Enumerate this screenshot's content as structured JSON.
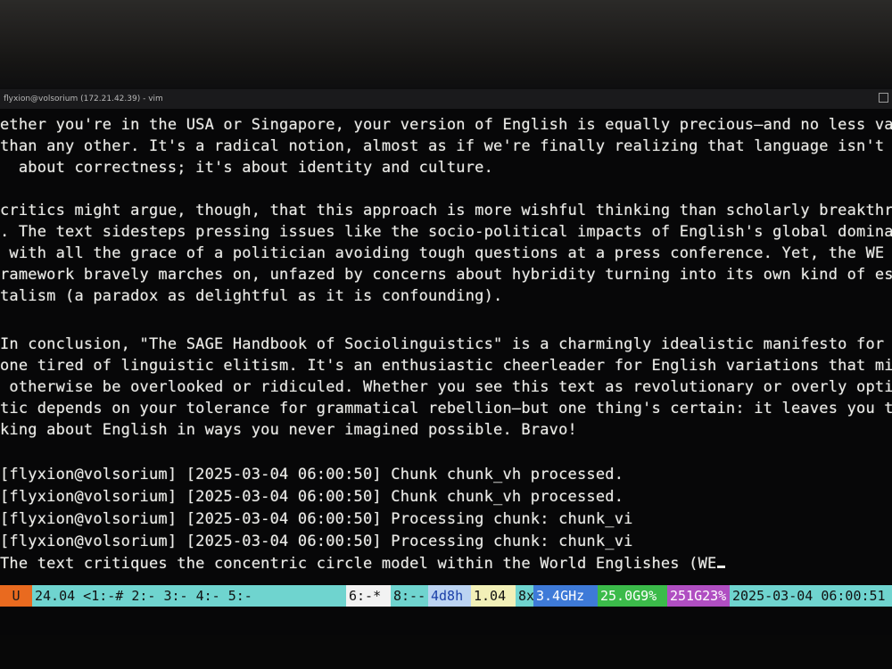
{
  "window": {
    "title": "flyxion@volsorium (172.21.42.39) - vim"
  },
  "terminal": {
    "lines": [
      "ether you're in the USA or Singapore, your version of English is equally precious—and no less vali",
      "than any other. It's a radical notion, almost as if we're finally realizing that language isn't j",
      "  about correctness; it's about identity and culture.",
      "",
      "critics might argue, though, that this approach is more wishful thinking than scholarly breakthro",
      ". The text sidesteps pressing issues like the socio-political impacts of English's global dominan",
      " with all the grace of a politician avoiding tough questions at a press conference. Yet, the WE f",
      "ramework bravely marches on, unfazed by concerns about hybridity turning into its own kind of essen",
      "talism (a paradox as delightful as it is confounding).",
      "",
      "In conclusion, \"The SAGE Handbook of Sociolinguistics\" is a charmingly idealistic manifesto for an",
      "one tired of linguistic elitism. It's an enthusiastic cheerleader for English variations that migh",
      " otherwise be overlooked or ridiculed. Whether you see this text as revolutionary or overly optimi",
      "tic depends on your tolerance for grammatical rebellion—but one thing's certain: it leaves you thi",
      "king about English in ways you never imagined possible. Bravo!",
      "",
      "[flyxion@volsorium] [2025-03-04 06:00:50] Chunk chunk_vh processed.",
      "[flyxion@volsorium] [2025-03-04 06:00:50] Chunk chunk_vh processed.",
      "[flyxion@volsorium] [2025-03-04 06:00:50] Processing chunk: chunk_vi",
      "[flyxion@volsorium] [2025-03-04 06:00:50] Processing chunk: chunk_vi",
      "The text critiques the concentric circle model within the World Englishes (WE"
    ]
  },
  "statusbar": {
    "segments": [
      {
        "text": "U",
        "bg": "#e96a1f",
        "fg": "#1a1a1a"
      },
      {
        "text": " 24.04 <1:-# 2:-  3:-  4:-  5:- ",
        "bg": "#6fd4cf",
        "fg": "#111111"
      },
      {
        "text": "6:-*",
        "bg": "#f2f2f2",
        "fg": "#111111"
      },
      {
        "text": " 8:--",
        "bg": "#6fd4cf",
        "fg": "#111111"
      },
      {
        "text": "4d8h",
        "bg": "#bcd4f2",
        "fg": "#1a3fa8"
      },
      {
        "text": " 1.04 ",
        "bg": "#f2f0b8",
        "fg": "#111111"
      },
      {
        "text": "8x",
        "bg": "#6fd4cf",
        "fg": "#111111"
      },
      {
        "text": "3.4GHz",
        "bg": "#3e7ad8",
        "fg": "#ffffff"
      },
      {
        "text": "25.0G9%",
        "bg": "#3bbb4a",
        "fg": "#ffffff"
      },
      {
        "text": "251G23%",
        "bg": "#b04ec2",
        "fg": "#ffffff"
      },
      {
        "text": " 2025-03-04 06:00:51",
        "bg": "#6fd4cf",
        "fg": "#111111"
      }
    ]
  }
}
